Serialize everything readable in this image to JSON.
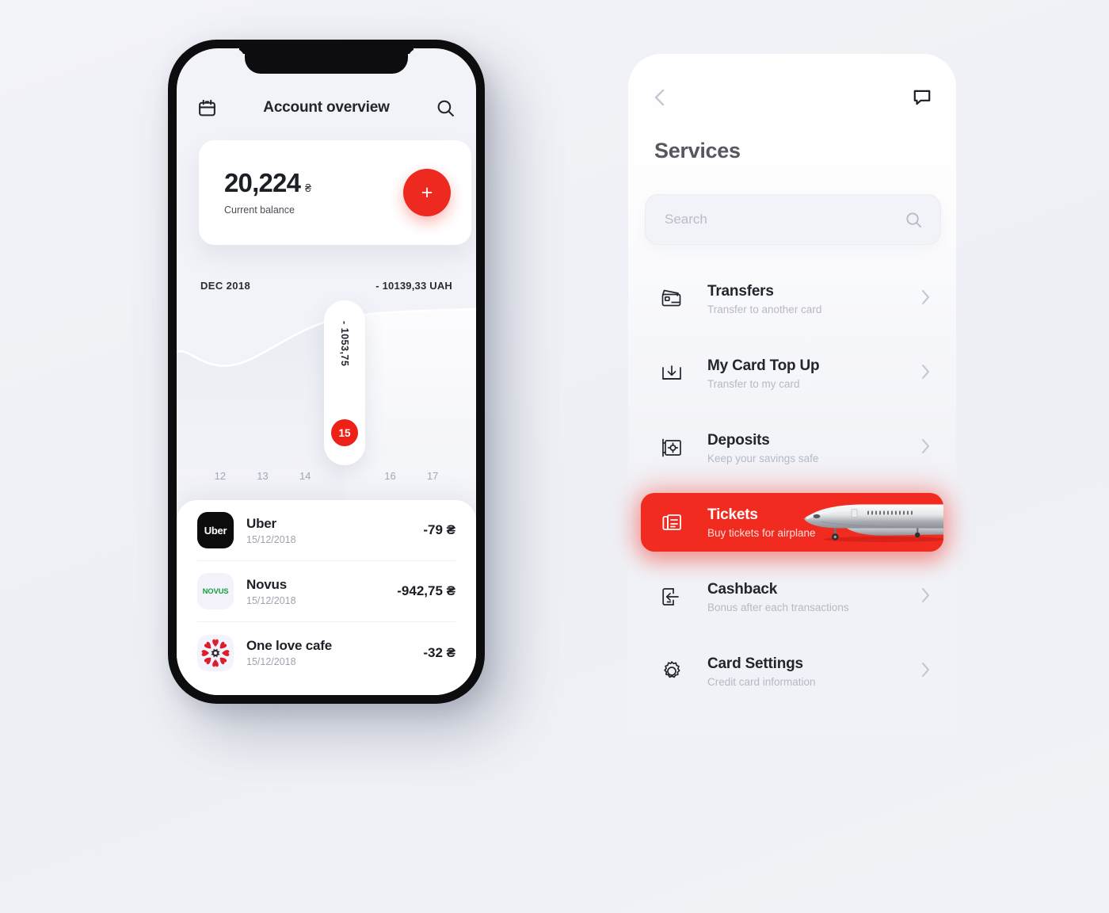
{
  "theme": {
    "accent": "#ee2a20",
    "accent_strong": "#f22b20",
    "background": "#f1f2f7",
    "text_dark": "#23252c",
    "text_muted": "#b6b9c5"
  },
  "phone": {
    "header": {
      "title": "Account overview",
      "calendar_icon": "calendar-icon",
      "search_icon": "search-icon"
    },
    "balance": {
      "amount": "20,224",
      "currency": "₴",
      "label": "Current balance",
      "add_label": "+"
    },
    "chart_header": {
      "month": "DEC 2018",
      "total": "- 10139,33 UAH"
    },
    "tooltip": {
      "value": "- 1053,75",
      "day": "15"
    },
    "transactions": [
      {
        "logo": "uber-logo",
        "logo_text": "Uber",
        "name": "Uber",
        "date": "15/12/2018",
        "amount": "-79 ₴"
      },
      {
        "logo": "novus-logo",
        "logo_text": "NOVUS",
        "name": "Novus",
        "date": "15/12/2018",
        "amount": "-942,75 ₴"
      },
      {
        "logo": "one-love-cafe-logo",
        "logo_text": "",
        "name": "One love cafe",
        "date": "15/12/2018",
        "amount": "-32 ₴"
      }
    ]
  },
  "chart_data": {
    "type": "line",
    "title": "DEC 2018",
    "annotation": "- 10139,33 UAH",
    "categories": [
      "12",
      "13",
      "14",
      "15",
      "16",
      "17"
    ],
    "x": [
      12,
      13,
      14,
      15,
      16,
      17
    ],
    "values": [
      -980,
      -1180,
      -1095,
      -1053.75,
      -900,
      -880
    ],
    "highlight_index": 3,
    "highlight_label": "- 1053,75",
    "xlabel": "",
    "ylabel": "",
    "grid": false,
    "legend": false
  },
  "panel": {
    "back_icon": "chevron-left-icon",
    "chat_icon": "chat-bubble-icon",
    "title": "Services",
    "search": {
      "value": "",
      "placeholder": "Search",
      "icon": "search-icon"
    },
    "services": [
      {
        "icon": "cards-icon",
        "title": "Transfers",
        "subtitle": "Transfer to another card",
        "active": false,
        "chevron": "chevron-right-icon"
      },
      {
        "icon": "download-icon",
        "title": "My Card Top Up",
        "subtitle": "Transfer to my card",
        "active": false,
        "chevron": "chevron-right-icon"
      },
      {
        "icon": "safe-icon",
        "title": "Deposits",
        "subtitle": "Keep your savings safe",
        "active": false,
        "chevron": "chevron-right-icon"
      },
      {
        "icon": "ticket-icon",
        "title": "Tickets",
        "subtitle": "Buy tickets for airplane",
        "active": true,
        "chevron": ""
      },
      {
        "icon": "cashback-icon",
        "title": "Cashback",
        "subtitle": "Bonus after each transactions",
        "active": false,
        "chevron": "chevron-right-icon"
      },
      {
        "icon": "gear-icon",
        "title": "Card Settings",
        "subtitle": "Credit card information",
        "active": false,
        "chevron": "chevron-right-icon"
      }
    ]
  }
}
